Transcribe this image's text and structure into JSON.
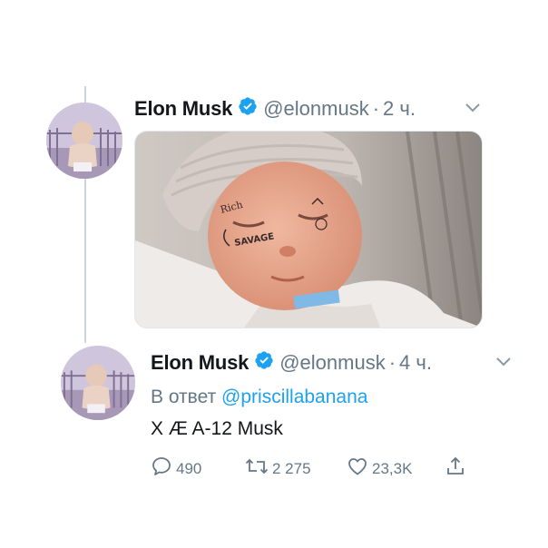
{
  "tweets": [
    {
      "author": {
        "name": "Elon Musk",
        "handle": "@elonmusk",
        "verified": true,
        "avatar": "toddler-avatar"
      },
      "separator": "·",
      "time": "2 ч.",
      "menu_icon": "chevron-down-icon",
      "media": {
        "type": "photo",
        "subject": "newborn-baby-photo",
        "face_tattoo_text": "SAVAGE"
      }
    },
    {
      "author": {
        "name": "Elon Musk",
        "handle": "@elonmusk",
        "verified": true,
        "avatar": "toddler-avatar"
      },
      "separator": "·",
      "time": "4 ч.",
      "menu_icon": "chevron-down-icon",
      "reply_prefix": "В ответ",
      "reply_to": "@priscillabanana",
      "text": "X Æ A-12 Musk",
      "actions": {
        "replies": "490",
        "retweets": "2 275",
        "likes": "23,3K",
        "reply_icon": "reply-bubble-icon",
        "retweet_icon": "retweet-icon",
        "like_icon": "heart-icon",
        "share_icon": "share-icon"
      }
    }
  ],
  "colors": {
    "text": "#14171a",
    "secondary": "#657786",
    "accent": "#1da1f2",
    "verified": "#1da1f2",
    "thread_line": "#ccd6dd"
  }
}
